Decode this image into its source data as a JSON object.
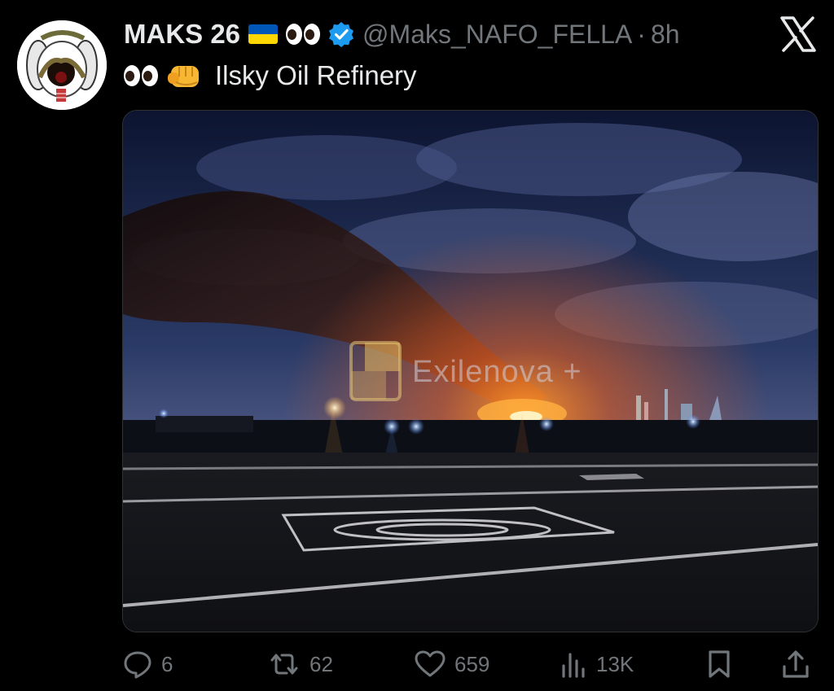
{
  "tweet": {
    "display_name": "MAKS 26",
    "handle": "@Maks_NAFO_FELLA",
    "separator": "·",
    "time": "8h",
    "verified": true,
    "text": "Ilsky Oil Refinery",
    "media": {
      "watermark": "Exilenova +"
    }
  },
  "actions": {
    "replies": "6",
    "reposts": "62",
    "likes": "659",
    "views": "13K"
  },
  "colors": {
    "background": "#000000",
    "text": "#e7e9ea",
    "muted": "#71767b",
    "verified_badge": "#1d9bf0"
  }
}
